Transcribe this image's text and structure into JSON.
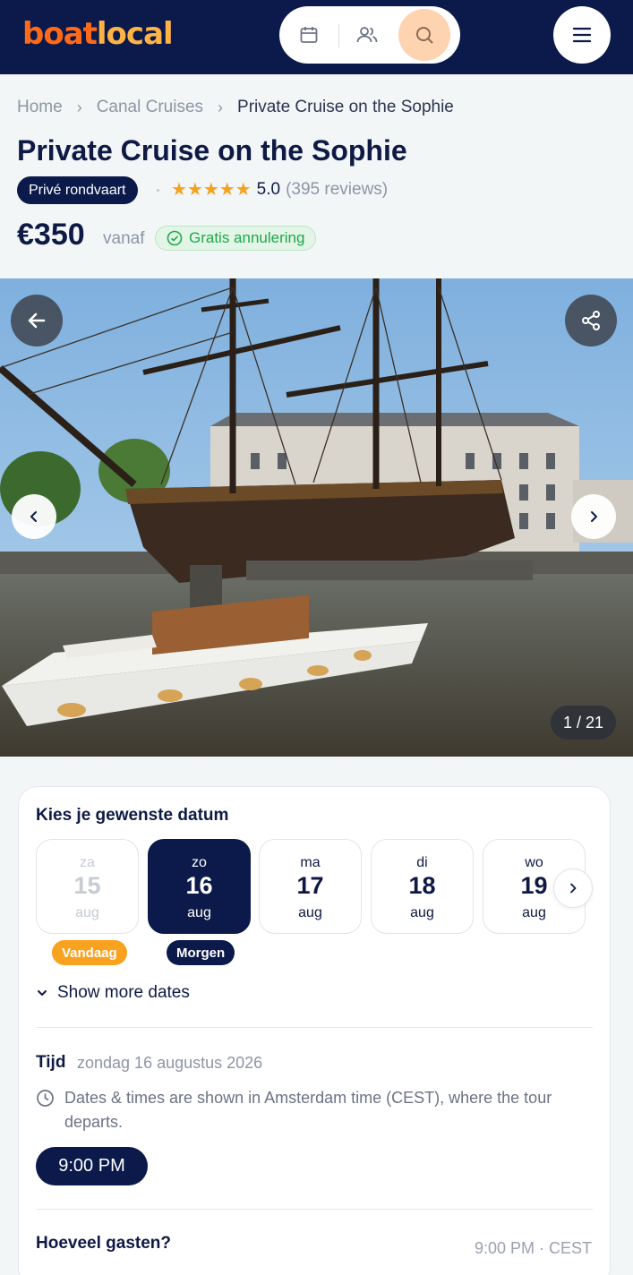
{
  "header": {
    "logo_part1": "boat",
    "logo_part2": "local",
    "icons": [
      "calendar-icon",
      "guests-icon",
      "search-icon",
      "menu-icon"
    ]
  },
  "breadcrumb": [
    "Home",
    "Canal Cruises",
    "Private Cruise on the Sophie"
  ],
  "product": {
    "title": "Private Cruise on the Sophie",
    "tag": "Privé rondvaart",
    "stars": "★★★★★",
    "rating": "5.0",
    "reviews": "(395 reviews)",
    "price": "€350",
    "price_suffix": "vanaf",
    "cancellation": "Gratis annulering"
  },
  "gallery": {
    "counter": "1 / 21"
  },
  "booking": {
    "date_heading": "Kies je gewenste datum",
    "days": [
      {
        "weekday": "za",
        "day": "15",
        "month": "aug",
        "state": "past"
      },
      {
        "weekday": "zo",
        "day": "16",
        "month": "aug",
        "state": "selected"
      },
      {
        "weekday": "ma",
        "day": "17",
        "month": "aug",
        "state": "available"
      },
      {
        "weekday": "di",
        "day": "18",
        "month": "aug",
        "state": "available"
      },
      {
        "weekday": "wo",
        "day": "19",
        "month": "aug",
        "state": "available"
      }
    ],
    "today_label": "Vandaag",
    "tomorrow_label": "Morgen",
    "show_more": "Show more dates",
    "time_label": "Tijd",
    "time_date": "zondag 16 augustus 2026",
    "timezone_note": "Dates & times are shown in Amsterdam time (CEST), where the tour departs.",
    "time_slot": "9:00 PM",
    "guests_label": "Hoeveel gasten?",
    "guests_time": "9:00 PM · CEST"
  },
  "colors": {
    "navy": "#0b1a4a",
    "orange": "#ff6a1a",
    "star": "#f6a21e",
    "green": "#1fa84b"
  }
}
